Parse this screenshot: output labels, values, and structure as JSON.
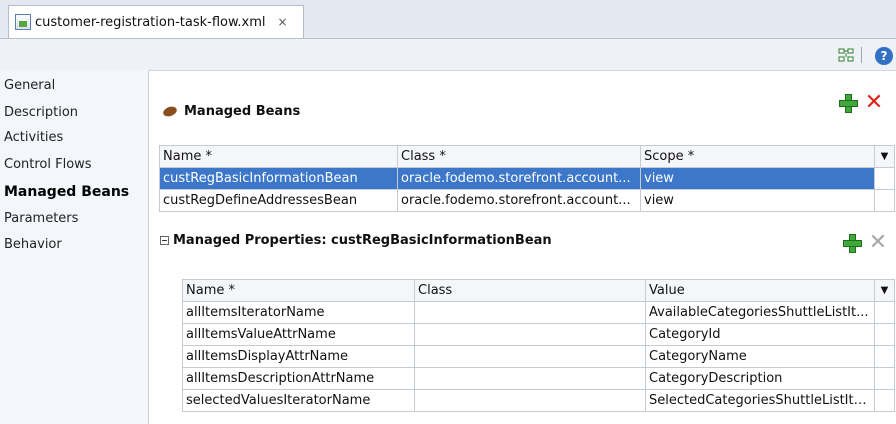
{
  "editor": {
    "file_tab": "customer-registration-task-flow.xml",
    "close_glyph": "×"
  },
  "toolbar": {
    "icons": [
      "diagram-icon",
      "help-icon"
    ],
    "help_glyph": "?"
  },
  "nav": {
    "items": [
      "General",
      "Description",
      "Activities",
      "Control Flows",
      "Managed Beans",
      "Parameters",
      "Behavior"
    ],
    "active": "Managed Beans"
  },
  "managed_beans": {
    "title": "Managed Beans",
    "columns": [
      "Name *",
      "Class *",
      "Scope *"
    ],
    "rows": [
      {
        "name": "custRegBasicInformationBean",
        "class": "oracle.fodemo.storefront.account...",
        "scope": "view"
      },
      {
        "name": "custRegDefineAddressesBean",
        "class": "oracle.fodemo.storefront.account...",
        "scope": "view"
      }
    ],
    "selected_index": 0
  },
  "managed_properties": {
    "title": "Managed Properties: custRegBasicInformationBean",
    "columns": [
      "Name *",
      "Class",
      "Value"
    ],
    "rows": [
      {
        "name": "allItemsIteratorName",
        "class": "",
        "value": "AvailableCategoriesShuttleListIt..."
      },
      {
        "name": "allItemsValueAttrName",
        "class": "",
        "value": "CategoryId"
      },
      {
        "name": "allItemsDisplayAttrName",
        "class": "",
        "value": "CategoryName"
      },
      {
        "name": "allItemsDescriptionAttrName",
        "class": "",
        "value": "CategoryDescription"
      },
      {
        "name": "selectedValuesIteratorName",
        "class": "",
        "value": "SelectedCategoriesShuttleListIte..."
      }
    ]
  },
  "colors": {
    "selection": "#3c77c9",
    "add_green": "#3fa83a",
    "delete_red": "#d9261c",
    "delete_disabled": "#a9a9a9"
  }
}
